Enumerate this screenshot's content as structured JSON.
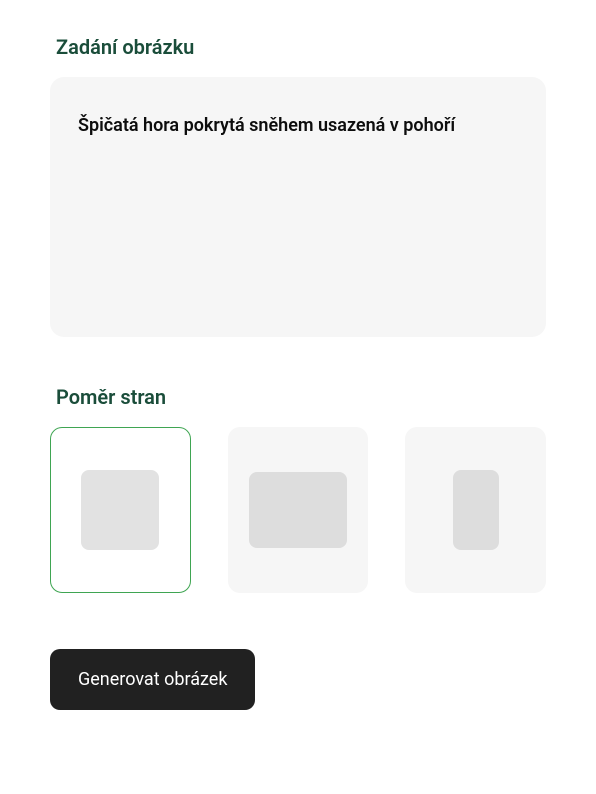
{
  "prompt_section": {
    "title": "Zadání obrázku",
    "value": "Špičatá hora pokrytá sněhem usazená v pohoří"
  },
  "aspect_ratio_section": {
    "title": "Poměr stran",
    "options": [
      {
        "id": "square",
        "selected": true
      },
      {
        "id": "landscape",
        "selected": false
      },
      {
        "id": "portrait",
        "selected": false
      }
    ]
  },
  "generate_button": {
    "label": "Generovat obrázek"
  }
}
